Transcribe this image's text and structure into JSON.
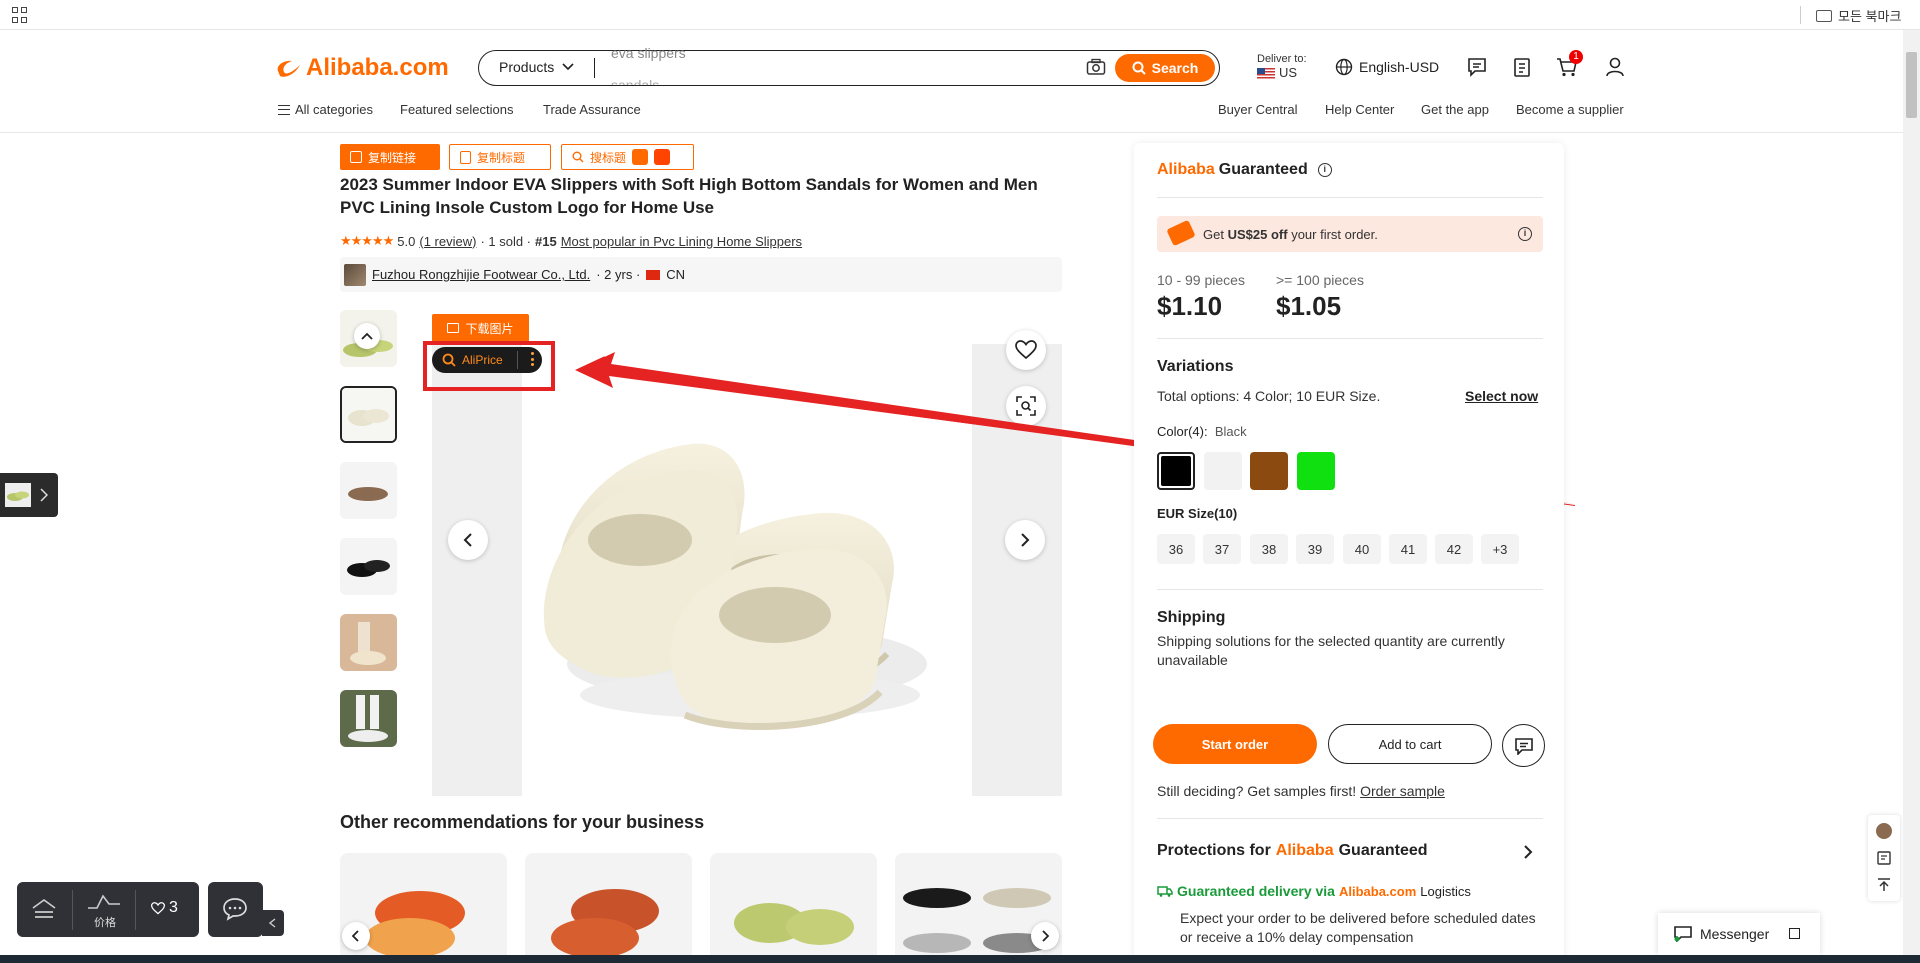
{
  "browser": {
    "bookmarks_all": "모든 북마크"
  },
  "header": {
    "logo_text": "Alibaba.com",
    "search": {
      "category": "Products",
      "placeholder": "eva slippers",
      "placeholder_next": "sandals",
      "button": "Search"
    },
    "deliver_to_label": "Deliver to:",
    "deliver_to_country": "US",
    "language_currency": "English-USD",
    "cart_count": "1",
    "nav_left": [
      "All categories",
      "Featured selections",
      "Trade Assurance"
    ],
    "nav_right": [
      "Buyer Central",
      "Help Center",
      "Get the app",
      "Become a supplier"
    ]
  },
  "extension_buttons": {
    "copy_link": "复制链接",
    "copy_title": "复制标题",
    "search_title": "搜标题",
    "download_images": "下载图片",
    "aliprice": "AliPrice"
  },
  "product": {
    "title": "2023 Summer Indoor EVA Slippers with Soft High Bottom Sandals for Women and Men PVC Lining Insole Custom Logo for Home Use",
    "stars": "★★★★★",
    "rating": "5.0",
    "reviews": "(1 review)",
    "sold": "· 1 sold ·",
    "rank": "#15",
    "rank_category": "Most popular in Pvc Lining Home Slippers",
    "supplier": "Fuzhou Rongzhijie Footwear Co., Ltd.",
    "supplier_years": "· 2 yrs ·",
    "supplier_country": "CN",
    "thumbnails": 6
  },
  "recommendations": {
    "title": "Other recommendations for your business"
  },
  "panel": {
    "guaranteed_brand": "Alibaba",
    "guaranteed_word": "Guaranteed",
    "coupon_prefix": "Get",
    "coupon_amount": "US$25 off",
    "coupon_suffix": "your first order.",
    "tiers": [
      {
        "range": "10 - 99 pieces",
        "price": "$1.10"
      },
      {
        "range": ">= 100 pieces",
        "price": "$1.05"
      }
    ],
    "variations_title": "Variations",
    "variations_summary": "Total options: 4 Color; 10 EUR Size.",
    "select_now": "Select now",
    "color_label": "Color(4):",
    "color_selected": "Black",
    "colors": [
      "#000000",
      "#f2f2f2",
      "#8b4a10",
      "#10e010"
    ],
    "size_label": "EUR Size(10)",
    "sizes": [
      "36",
      "37",
      "38",
      "39",
      "40",
      "41",
      "42",
      "+3"
    ],
    "shipping_title": "Shipping",
    "shipping_text": "Shipping solutions for the selected quantity are currently unavailable",
    "start_order": "Start order",
    "add_to_cart": "Add to cart",
    "sample_prefix": "Still deciding? Get samples first!",
    "order_sample": "Order sample",
    "protections_prefix": "Protections for",
    "delivery_title_prefix": "Guaranteed delivery via",
    "delivery_brand": "Alibaba.com",
    "delivery_logistics": "Logistics",
    "delivery_text": "Expect your order to be delivered before scheduled dates or receive a 10% delay compensation"
  },
  "widgets": {
    "price_label": "价格",
    "favorites_count": "3",
    "messenger": "Messenger"
  },
  "colors": {
    "brand": "#ff6a00",
    "annotation": "#e52323"
  }
}
